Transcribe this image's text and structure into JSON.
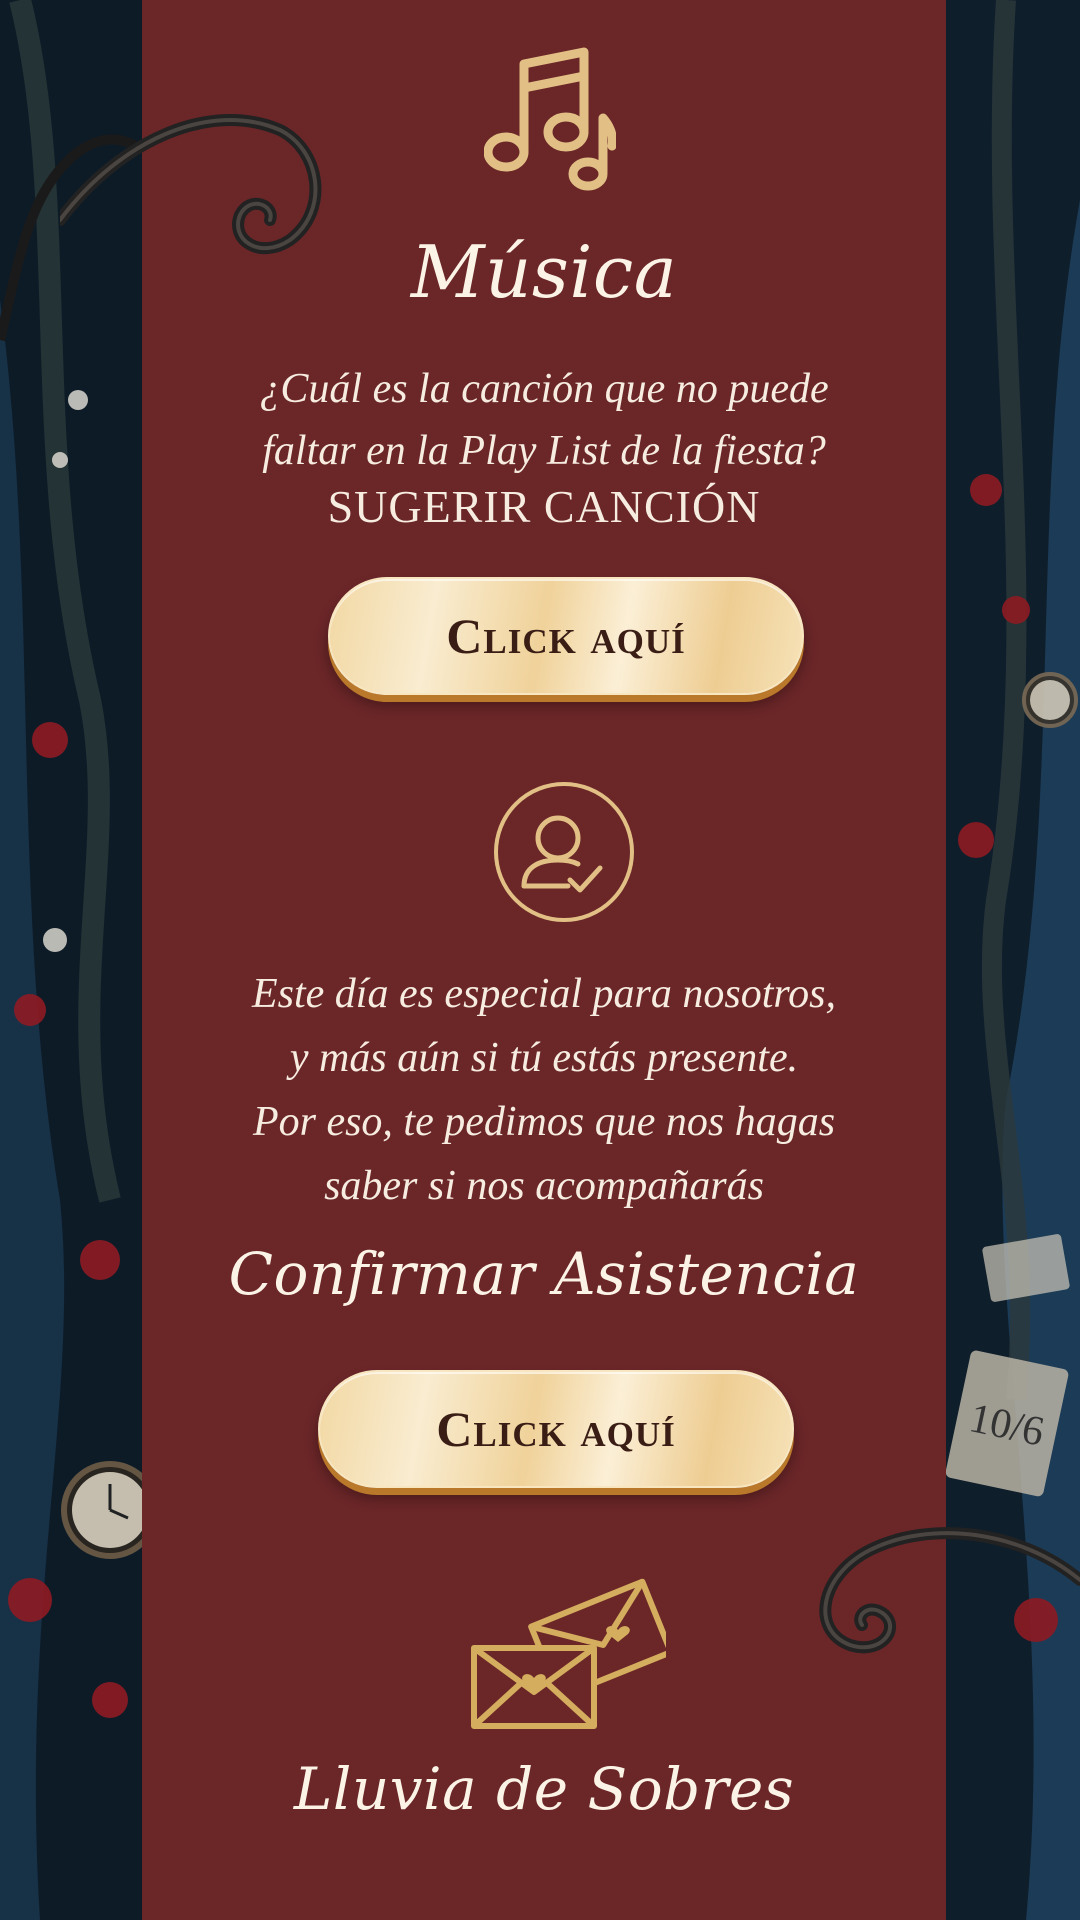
{
  "colors": {
    "panel": "#6b2628",
    "gold": "#e2c085",
    "text": "#f6ece0",
    "button_text": "#3a1e16"
  },
  "music": {
    "icon": "music-notes-icon",
    "title": "Música",
    "question_line1": "¿Cuál es la canción que no puede",
    "question_line2": "faltar en la Play List de la fiesta?",
    "suggest_label": "SUGERIR CANCIÓN",
    "button_label": "Click aquí"
  },
  "rsvp": {
    "icon": "user-check-icon",
    "line1": "Este día es especial para nosotros,",
    "line2": "y más aún si tú estás presente.",
    "line3": "Por eso, te pedimos que nos hagas",
    "line4": "saber si nos acompañarás",
    "title": "Confirmar Asistencia",
    "button_label": "Click aquí"
  },
  "gifts": {
    "icon": "envelopes-icon",
    "title": "Lluvia de Sobres"
  },
  "decor": {
    "card_text": "10/6"
  }
}
